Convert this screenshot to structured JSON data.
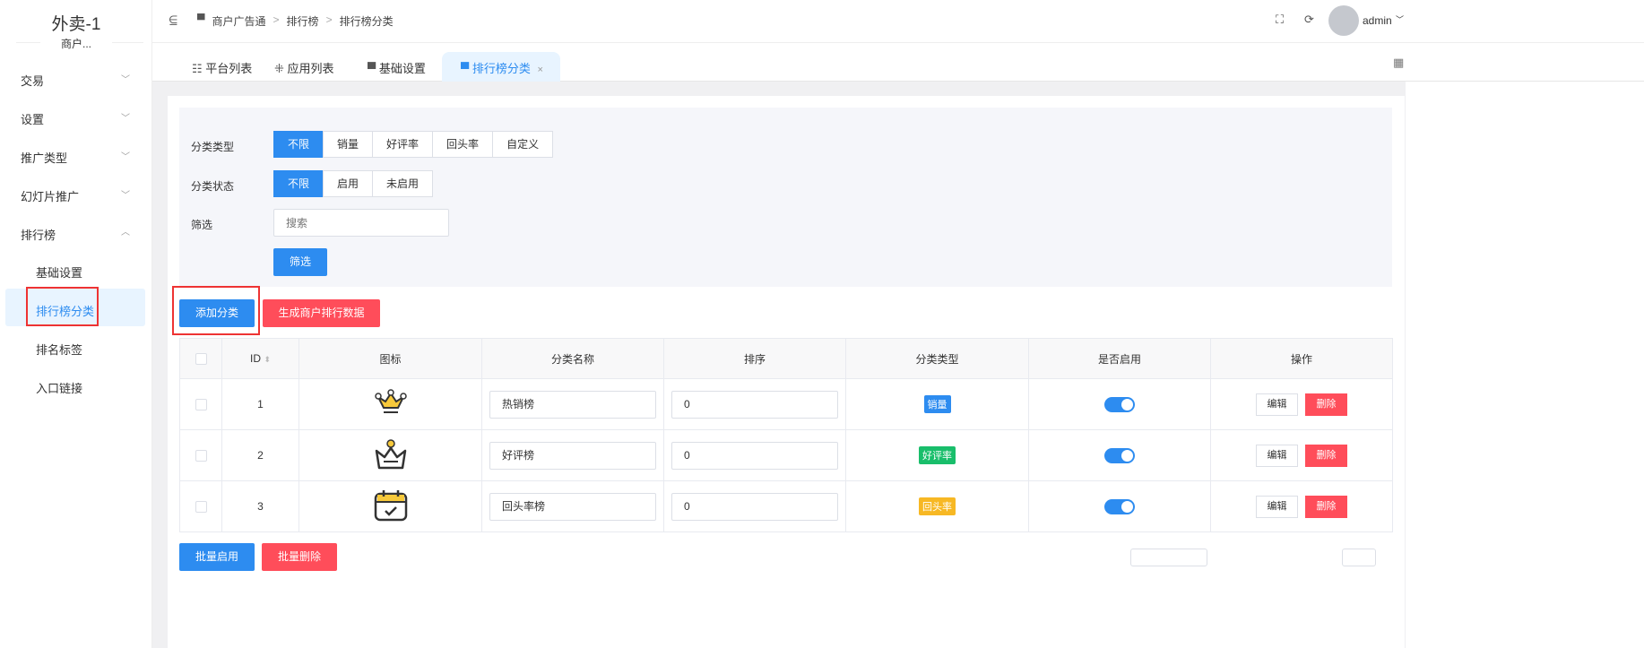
{
  "sidebar": {
    "title": "外卖-1",
    "subtitle": "商户...",
    "menu": [
      "交易",
      "设置",
      "推广类型",
      "幻灯片推广",
      "排行榜"
    ],
    "submenu": [
      "基础设置",
      "排行榜分类",
      "排名标签",
      "入口链接"
    ]
  },
  "header": {
    "breadcrumb": [
      "商户广告通",
      "排行榜",
      "排行榜分类"
    ],
    "user": "admin"
  },
  "tabs": [
    "平台列表",
    "应用列表",
    "基础设置",
    "排行榜分类"
  ],
  "filter": {
    "type_label": "分类类型",
    "type_options": [
      "不限",
      "销量",
      "好评率",
      "回头率",
      "自定义"
    ],
    "status_label": "分类状态",
    "status_options": [
      "不限",
      "启用",
      "未启用"
    ],
    "search_label": "筛选",
    "search_placeholder": "搜索",
    "submit": "筛选"
  },
  "actions": {
    "add": "添加分类",
    "generate": "生成商户排行数据"
  },
  "table": {
    "headers": [
      "ID",
      "图标",
      "分类名称",
      "排序",
      "分类类型",
      "是否启用",
      "操作"
    ],
    "rows": [
      {
        "id": "1",
        "name": "热销榜",
        "sort": "0",
        "type": "销量",
        "type_color": "#2d8cf0",
        "enabled": true
      },
      {
        "id": "2",
        "name": "好评榜",
        "sort": "0",
        "type": "好评率",
        "type_color": "#19be6b",
        "enabled": true
      },
      {
        "id": "3",
        "name": "回头率榜",
        "sort": "0",
        "type": "回头率",
        "type_color": "#f7b824",
        "enabled": true
      }
    ],
    "edit": "编辑",
    "delete": "删除"
  },
  "bottom": {
    "batch_enable": "批量启用",
    "batch_delete": "批量删除"
  }
}
